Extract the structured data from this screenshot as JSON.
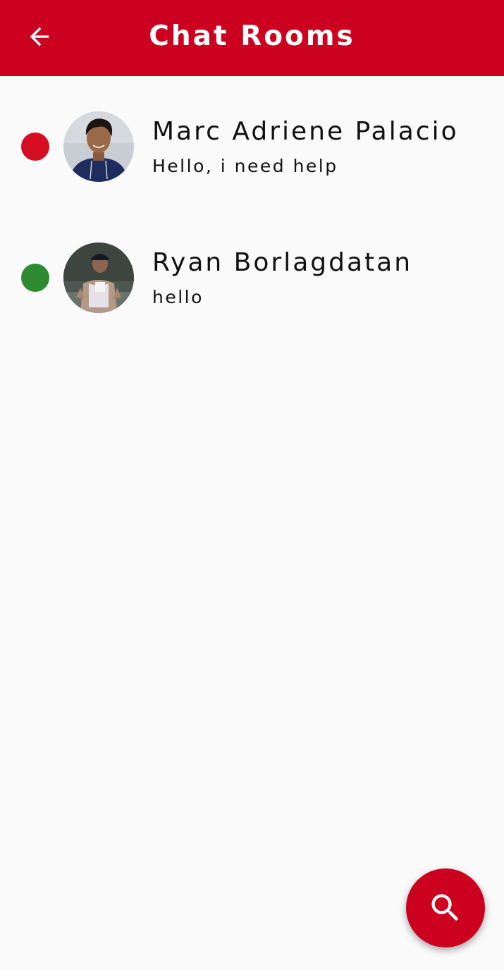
{
  "appbar": {
    "title": "Chat Rooms",
    "back_icon": "arrow-left-icon",
    "color": "#cc001f"
  },
  "rooms": [
    {
      "name": "Marc Adriene Palacio",
      "last_message": "Hello, i need help",
      "status": "offline",
      "status_color": "#d50e23"
    },
    {
      "name": "Ryan Borlagdatan",
      "last_message": "hello",
      "status": "online",
      "status_color": "#2e8b32"
    }
  ],
  "fab": {
    "icon": "search-icon",
    "color": "#cc001f"
  }
}
